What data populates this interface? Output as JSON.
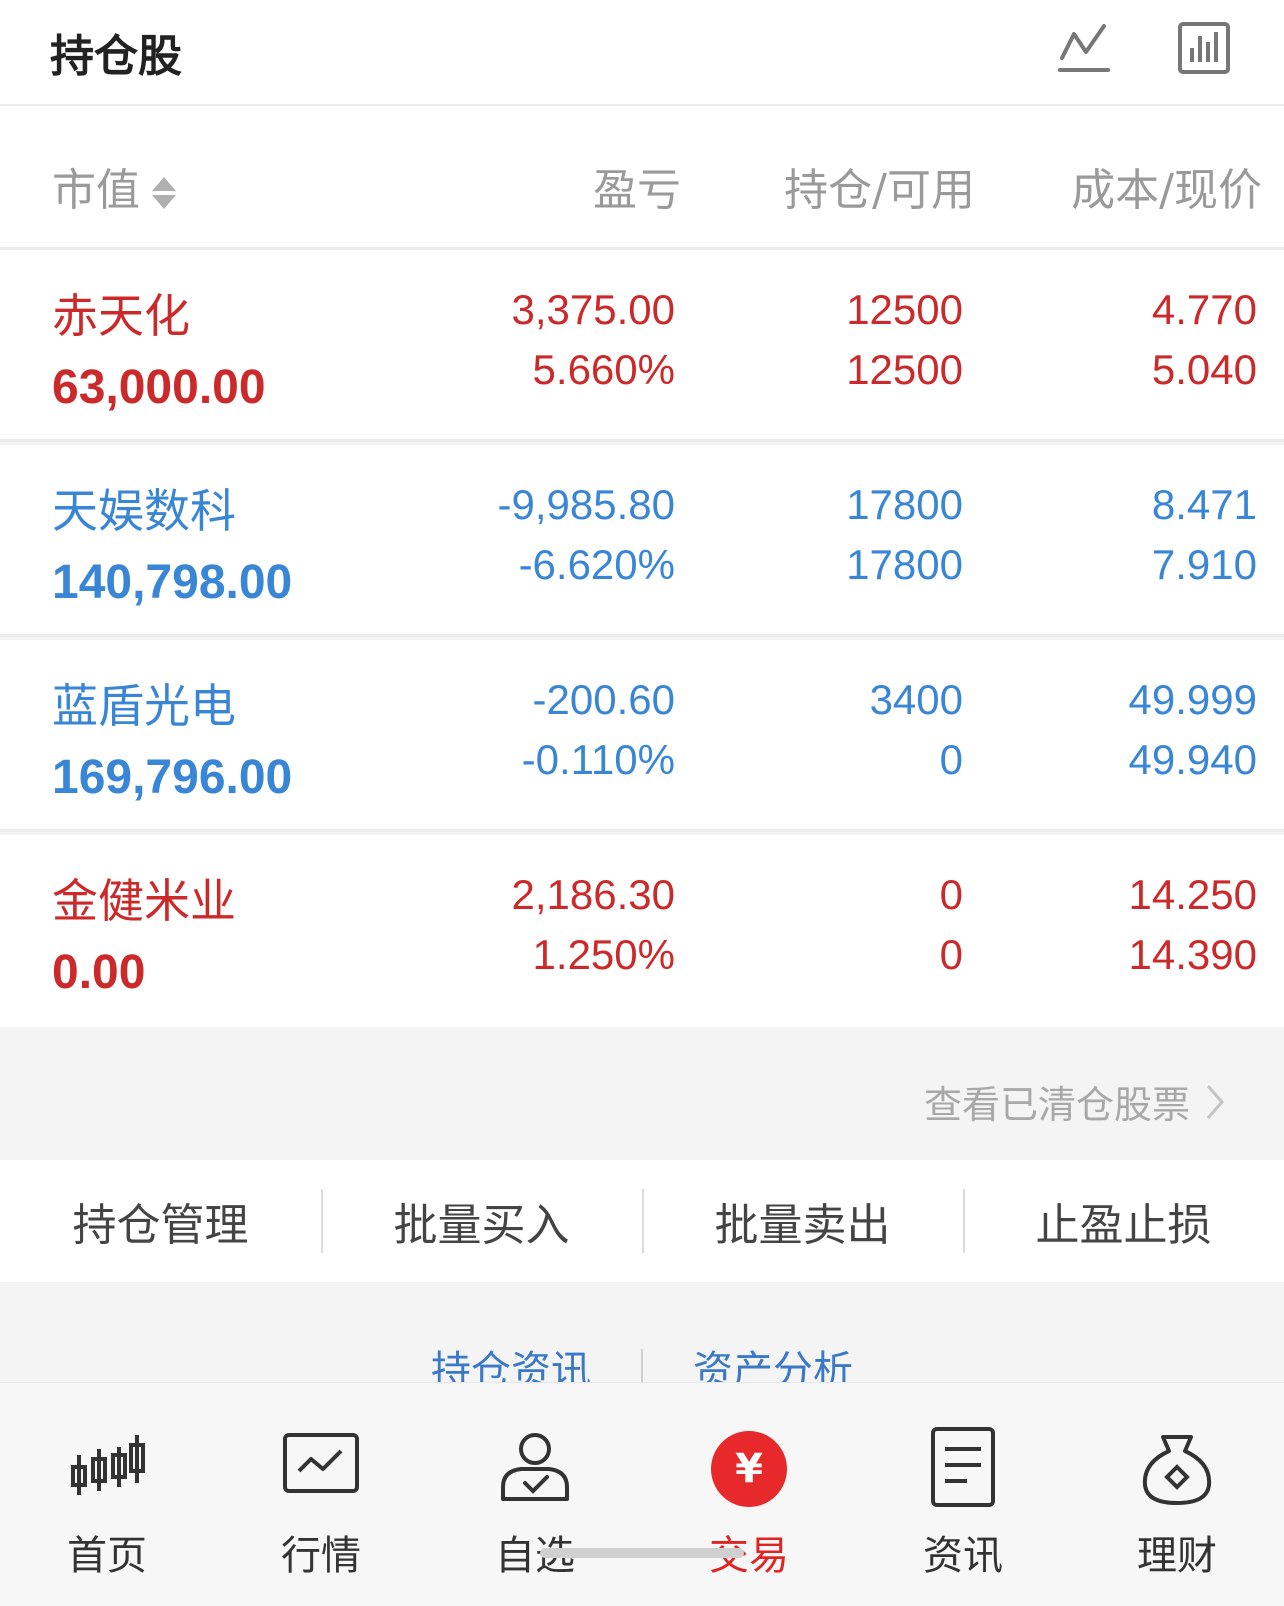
{
  "header": {
    "title": "持仓股",
    "icons": [
      "trend-line-icon",
      "bar-chart-icon"
    ]
  },
  "columns": {
    "market_value": "市值",
    "pnl": "盈亏",
    "position": "持仓/可用",
    "cost": "成本/现价"
  },
  "holdings": [
    {
      "name": "赤天化",
      "market_value": "63,000.00",
      "pnl": "3,375.00",
      "pnl_pct": "5.660%",
      "position": "12500",
      "available": "12500",
      "cost": "4.770",
      "price": "5.040",
      "color": "#cc2a2a"
    },
    {
      "name": "天娱数科",
      "market_value": "140,798.00",
      "pnl": "-9,985.80",
      "pnl_pct": "-6.620%",
      "position": "17800",
      "available": "17800",
      "cost": "8.471",
      "price": "7.910",
      "color": "#3a86d6"
    },
    {
      "name": "蓝盾光电",
      "market_value": "169,796.00",
      "pnl": "-200.60",
      "pnl_pct": "-0.110%",
      "position": "3400",
      "available": "0",
      "cost": "49.999",
      "price": "49.940",
      "color": "#3a86d6"
    },
    {
      "name": "金健米业",
      "market_value": "0.00",
      "pnl": "2,186.30",
      "pnl_pct": "1.250%",
      "position": "0",
      "available": "0",
      "cost": "14.250",
      "price": "14.390",
      "color": "#cc2a2a"
    }
  ],
  "cleared_link": "查看已清仓股票",
  "actions": [
    "持仓管理",
    "批量买入",
    "批量卖出",
    "止盈止损"
  ],
  "links": [
    "持仓资讯",
    "资产分析"
  ],
  "tabbar": [
    {
      "label": "首页",
      "icon": "candlestick-icon"
    },
    {
      "label": "行情",
      "icon": "market-chart-icon"
    },
    {
      "label": "自选",
      "icon": "user-check-icon"
    },
    {
      "label": "交易",
      "icon": "yen-circle-icon",
      "glyph": "¥",
      "active": true
    },
    {
      "label": "资讯",
      "icon": "document-icon"
    },
    {
      "label": "理财",
      "icon": "money-bag-icon"
    }
  ]
}
